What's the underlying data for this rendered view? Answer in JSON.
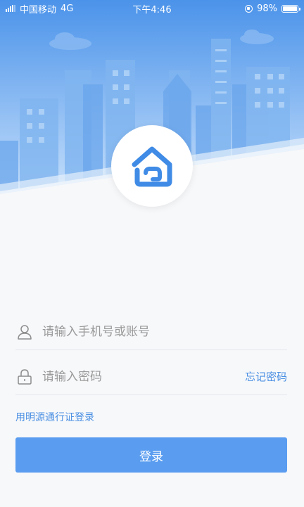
{
  "status_bar": {
    "carrier": "中国移动",
    "network": "4G",
    "time": "下午4:46",
    "battery": "98%"
  },
  "login": {
    "account_placeholder": "请输入手机号或账号",
    "password_placeholder": "请输入密码",
    "forgot_label": "忘记密码",
    "alt_login_label": "用明源通行证登录",
    "submit_label": "登录"
  },
  "colors": {
    "accent": "#4a8fe3",
    "button": "#5a9df0",
    "sky_top": "#4d95ea",
    "sky_bottom": "#c7e0fb"
  },
  "icons": {
    "logo": "house-logo-icon",
    "account": "user-icon",
    "password": "lock-icon"
  }
}
